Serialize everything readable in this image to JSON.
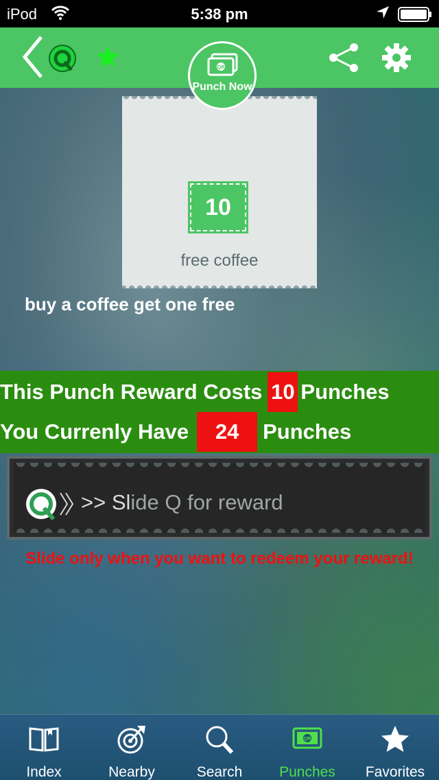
{
  "status_bar": {
    "carrier": "iPod",
    "time": "5:38 pm",
    "icons": [
      "wifi-icon",
      "location-arrow-icon",
      "battery-icon"
    ]
  },
  "nav": {
    "icons": [
      "back-chevron-icon",
      "q-logo-icon",
      "star-icon",
      "share-icon",
      "gear-icon"
    ],
    "punch_now_label": "Punch Now",
    "punch_now_icon": "qr-ticket-icon"
  },
  "ticket": {
    "punch_count": "10",
    "caption": "free coffee"
  },
  "reward_description": "buy a coffee get one free",
  "info": {
    "cost_prefix": "This Punch Reward Costs",
    "cost_value": "10",
    "cost_suffix": "Punches",
    "have_prefix": "You Currenly Have",
    "have_value": "24",
    "have_suffix": "Punches"
  },
  "slider": {
    "knob_icon": "q-slide-knob-icon",
    "label_strong": ">> Sl",
    "label_rest": "ide Q for reward"
  },
  "slide_warning": "Slide only when you want to redeem your reward!",
  "tabs": [
    {
      "label": "Index",
      "icon": "book-icon",
      "active": false
    },
    {
      "label": "Nearby",
      "icon": "compass-icon",
      "active": false
    },
    {
      "label": "Search",
      "icon": "search-icon",
      "active": false
    },
    {
      "label": "Punches",
      "icon": "qr-ticket-icon",
      "active": true
    },
    {
      "label": "Favorites",
      "icon": "star-icon",
      "active": false
    }
  ],
  "colors": {
    "brand_green": "#4cc564",
    "band_green": "#2b8d10",
    "alert_red": "#ee1111",
    "active_tab": "#4ee04a"
  }
}
